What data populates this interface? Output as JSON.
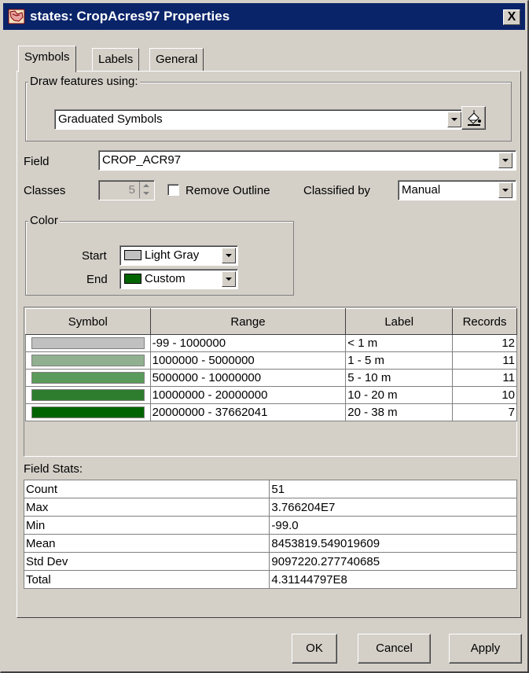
{
  "window": {
    "title": "states: CropAcres97 Properties",
    "close_glyph": "X"
  },
  "tabs": [
    {
      "label": "Symbols"
    },
    {
      "label": "Labels"
    },
    {
      "label": "General"
    }
  ],
  "draw_group": {
    "legend": "Draw features using:",
    "value": "Graduated Symbols"
  },
  "field": {
    "label": "Field",
    "value": "CROP_ACR97"
  },
  "classes": {
    "label": "Classes",
    "value": "5"
  },
  "remove_outline": {
    "label": "Remove Outline",
    "checked": false
  },
  "classified_by": {
    "label": "Classified by",
    "value": "Manual"
  },
  "color_group": {
    "legend": "Color",
    "start": {
      "label": "Start",
      "value": "Light Gray",
      "swatch": "#c0c0c0"
    },
    "end": {
      "label": "End",
      "value": "Custom",
      "swatch": "#006400"
    }
  },
  "class_table": {
    "headers": [
      "Symbol",
      "Range",
      "Label",
      "Records"
    ],
    "rows": [
      {
        "color": "#c0c0c0",
        "range": "-99 - 1000000",
        "label": "< 1 m",
        "records": "12"
      },
      {
        "color": "#90b090",
        "range": "1000000 - 5000000",
        "label": "1 - 5 m",
        "records": "11"
      },
      {
        "color": "#5a9a5a",
        "range": "5000000 - 10000000",
        "label": "5 - 10 m",
        "records": "11"
      },
      {
        "color": "#2e7d2e",
        "range": "10000000 - 20000000",
        "label": "10 - 20 m",
        "records": "10"
      },
      {
        "color": "#006400",
        "range": "20000000 - 37662041",
        "label": "20 - 38 m",
        "records": "7"
      }
    ]
  },
  "field_stats": {
    "heading": "Field Stats:",
    "rows": [
      {
        "name": "Count",
        "value": "51"
      },
      {
        "name": "Max",
        "value": "3.766204E7"
      },
      {
        "name": "Min",
        "value": "-99.0"
      },
      {
        "name": "Mean",
        "value": "8453819.549019609"
      },
      {
        "name": "Std Dev",
        "value": "9097220.277740685"
      },
      {
        "name": "Total",
        "value": "4.31144797E8"
      }
    ]
  },
  "buttons": {
    "ok": "OK",
    "cancel": "Cancel",
    "apply": "Apply"
  }
}
